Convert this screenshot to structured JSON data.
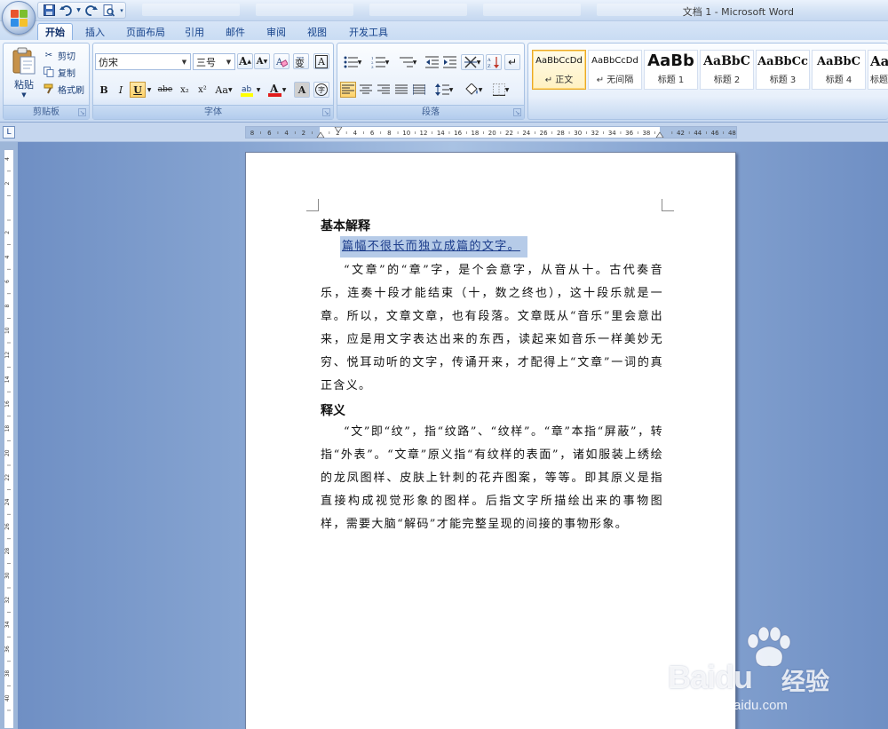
{
  "window": {
    "title": "文档 1 - Microsoft Word"
  },
  "qat": {
    "icons": [
      "save-icon",
      "undo-icon",
      "redo-icon",
      "print-preview-icon"
    ]
  },
  "tabs": [
    {
      "label": "开始",
      "active": true
    },
    {
      "label": "插入"
    },
    {
      "label": "页面布局"
    },
    {
      "label": "引用"
    },
    {
      "label": "邮件"
    },
    {
      "label": "审阅"
    },
    {
      "label": "视图"
    },
    {
      "label": "开发工具"
    }
  ],
  "clipboard": {
    "group_label": "剪贴板",
    "paste_label": "粘贴",
    "cut_label": "剪切",
    "copy_label": "复制",
    "format_painter_label": "格式刷"
  },
  "font": {
    "group_label": "字体",
    "font_name": "仿宋",
    "font_size": "三号",
    "grow_label": "A",
    "shrink_label": "A",
    "bold": "B",
    "italic": "I",
    "underline": "U",
    "strike": "abe",
    "subscript": "x₂",
    "superscript": "x²",
    "change_case": "Aa",
    "highlight_color": "#ffff00",
    "font_color": "#e11b1b",
    "char_shade": "A",
    "enclose": "字"
  },
  "paragraph": {
    "group_label": "段落"
  },
  "styles": {
    "items": [
      {
        "sample": "AaBbCcDd",
        "name": "↵ 正文",
        "selected": true
      },
      {
        "sample": "AaBbCcDd",
        "name": "↵ 无间隔"
      },
      {
        "sample": "AaBb",
        "name": "标题 1"
      },
      {
        "sample": "AaBbC",
        "name": "标题 2"
      },
      {
        "sample": "AaBbCc",
        "name": "标题 3"
      },
      {
        "sample": "AaBbC",
        "name": "标题 4"
      },
      {
        "sample": "Aa",
        "name": "标题"
      }
    ]
  },
  "ruler": {
    "labels": [
      "8",
      "6",
      "4",
      "2",
      "",
      "2",
      "4",
      "6",
      "8",
      "10",
      "12",
      "14",
      "16",
      "18",
      "20",
      "22",
      "24",
      "26",
      "28",
      "30",
      "32",
      "34",
      "36",
      "38",
      "",
      "42",
      "44",
      "46",
      "48"
    ],
    "v_labels": [
      "4",
      "2",
      "",
      "2",
      "4",
      "6",
      "8",
      "10",
      "12",
      "14",
      "16",
      "18",
      "20",
      "22",
      "24",
      "26",
      "28",
      "30",
      "32",
      "34",
      "36",
      "38",
      "40"
    ]
  },
  "document": {
    "heading1": "基本解释",
    "selected_line": "篇幅不很长而独立成篇的文字。",
    "para1": "“文章”的“章”字，是个会意字，从音从十。古代奏音乐，连奏十段才能结束（十，数之终也），这十段乐就是一章。所以，文章文章，也有段落。文章既从“音乐”里会意出来，应是用文字表达出来的东西，读起来如音乐一样美妙无穷、悦耳动听的文字，传诵开来，才配得上“文章”一词的真正含义。",
    "heading2": "释义",
    "para2": "“文”即“纹”，指“纹路”、“纹样”。“章”本指“屏蔽”，转指“外表”。“文章”原义指“有纹样的表面”，诸如服装上绣绘的龙凤图样、皮肤上针刺的花卉图案，等等。即其原义是指直接构成视觉形象的图样。后指文字所描绘出来的事物图样，需要大脑“解码”才能完整呈现的间接的事物形象。"
  },
  "watermark": {
    "brand": "Baidu",
    "brand_cn": "经验",
    "url": "jingyan.baidu.com"
  }
}
